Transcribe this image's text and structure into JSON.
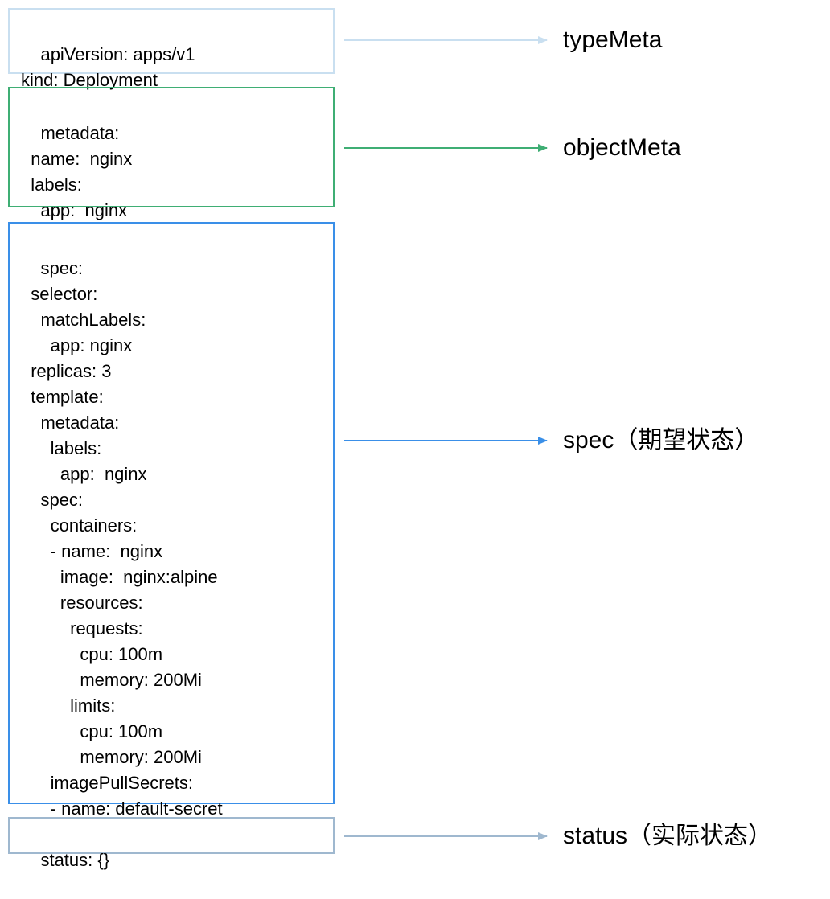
{
  "colors": {
    "typeMeta": "#c9dff0",
    "objectMeta": "#3fae74",
    "spec": "#3a8fe8",
    "status": "#9fb8cf"
  },
  "boxes": {
    "typeMeta": {
      "lines": [
        "apiVersion: apps/v1",
        "kind: Deployment"
      ]
    },
    "objectMeta": {
      "lines": [
        "metadata:",
        "  name:  nginx",
        "  labels:",
        "    app:  nginx"
      ]
    },
    "spec": {
      "lines": [
        "spec:",
        "  selector:",
        "    matchLabels:",
        "      app: nginx",
        "  replicas: 3",
        "  template:",
        "    metadata:",
        "      labels:",
        "        app:  nginx",
        "    spec:",
        "      containers:",
        "      - name:  nginx",
        "        image:  nginx:alpine",
        "        resources:",
        "          requests:",
        "            cpu: 100m",
        "            memory: 200Mi",
        "          limits:",
        "            cpu: 100m",
        "            memory: 200Mi",
        "      imagePullSecrets:",
        "      - name: default-secret"
      ]
    },
    "status": {
      "lines": [
        "status: {}"
      ]
    }
  },
  "labels": {
    "typeMeta": "typeMeta",
    "objectMeta": "objectMeta",
    "spec": "spec（期望状态）",
    "status": "status（实际状态）"
  }
}
